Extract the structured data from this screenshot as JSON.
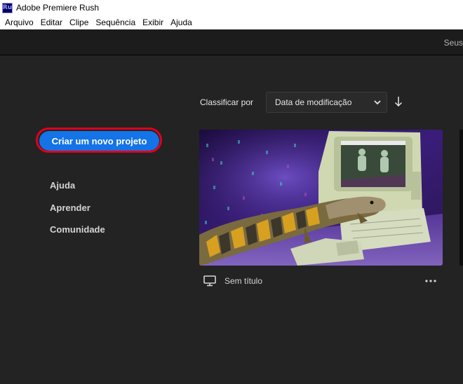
{
  "window": {
    "title": "Adobe Premiere Rush",
    "app_icon_text": "Ru"
  },
  "menubar": {
    "items": [
      "Arquivo",
      "Editar",
      "Clipe",
      "Sequência",
      "Exibir",
      "Ajuda"
    ]
  },
  "topbar": {
    "right_text": "Seus"
  },
  "sidebar": {
    "new_project_label": "Criar um novo projeto",
    "links": [
      "Ajuda",
      "Aprender",
      "Comunidade"
    ]
  },
  "sort": {
    "label": "Classificar por",
    "selected": "Data de modificação",
    "direction": "descending"
  },
  "projects": [
    {
      "title": "Sem título",
      "type_icon": "monitor-icon"
    }
  ],
  "colors": {
    "accent_button": "#1473e6",
    "highlight_ring": "#e0001a",
    "background": "#232323",
    "app_icon_bg": "#00005b"
  }
}
